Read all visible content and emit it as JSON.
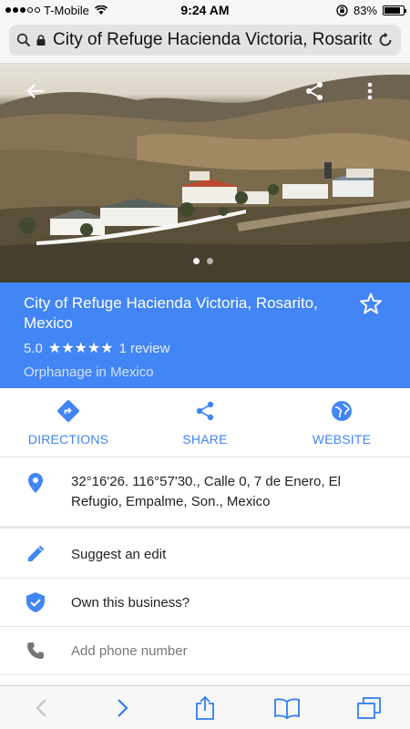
{
  "status_bar": {
    "carrier": "T-Mobile",
    "time": "9:24 AM",
    "battery": "83%",
    "battery_level": 0.83
  },
  "browser": {
    "url_text": "City of Refuge Hacienda Victoria, Rosarito"
  },
  "place": {
    "title": "City of Refuge Hacienda Victoria, Rosarito, Mexico",
    "rating": "5.0",
    "stars": "★★★★★",
    "reviews": "1 review",
    "category": "Orphanage in Mexico",
    "photo_count": 2,
    "active_photo": 1
  },
  "actions": {
    "directions": "DIRECTIONS",
    "share": "SHARE",
    "website": "WEBSITE"
  },
  "details": {
    "address": "32°16'26. 116°57'30., Calle 0, 7 de Enero, El Refugio, Empalme, Son., Mexico",
    "suggest_edit": "Suggest an edit",
    "own_business": "Own this business?",
    "add_phone": "Add phone number"
  },
  "colors": {
    "accent": "#4285f4",
    "icon_gray": "#757575"
  },
  "icons": [
    "search-icon",
    "lock-icon",
    "reload-icon",
    "back-arrow-icon",
    "share-icon",
    "more-vert-icon",
    "star-outline-icon",
    "directions-icon",
    "globe-icon",
    "location-pin-icon",
    "pencil-icon",
    "verified-shield-icon",
    "phone-icon",
    "chevron-left-icon",
    "chevron-right-icon",
    "share-box-icon",
    "book-icon",
    "tabs-icon"
  ]
}
